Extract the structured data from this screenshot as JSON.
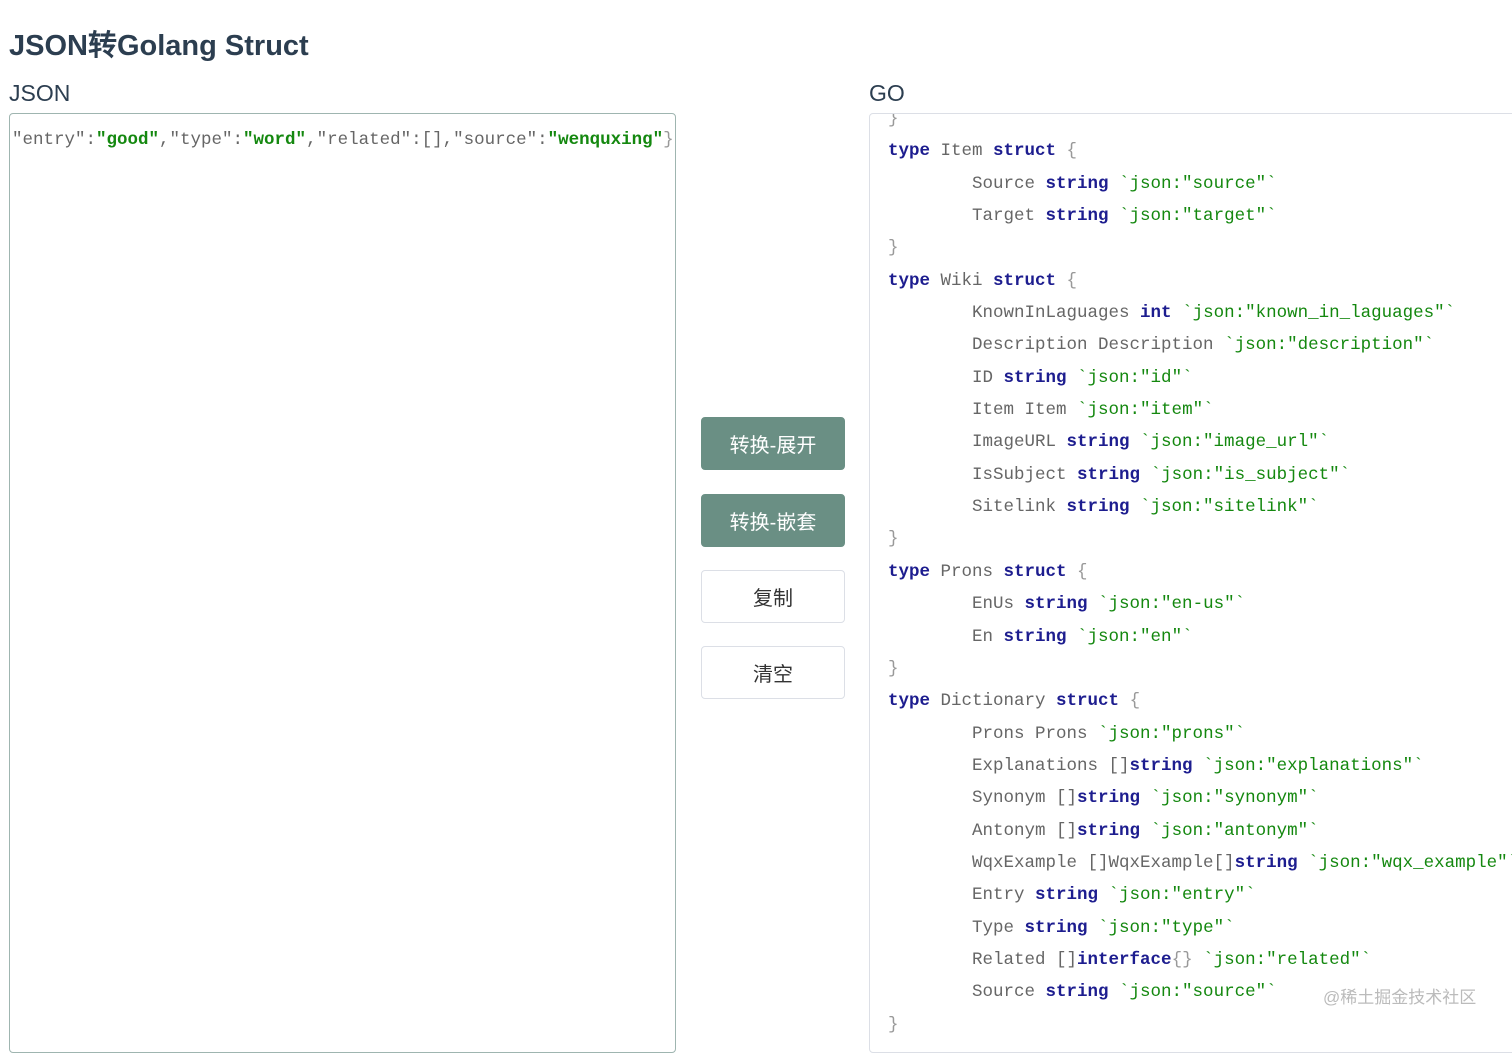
{
  "page_title": "JSON转Golang Struct",
  "json_panel": {
    "label": "JSON",
    "tokens": [
      [
        "i",
        "\"entry\":"
      ],
      [
        "sv",
        "\"good\""
      ],
      [
        "i",
        ",\"type\":"
      ],
      [
        "sv",
        "\"word\""
      ],
      [
        "i",
        ",\"related\":[],\"source\":"
      ],
      [
        "sv",
        "\"wenquxing\""
      ],
      [
        "p",
        "}}"
      ]
    ]
  },
  "go_panel": {
    "label": "GO",
    "lines": [
      [
        [
          "p",
          "}"
        ]
      ],
      [
        [
          "k",
          "type"
        ],
        [
          "i",
          " Item "
        ],
        [
          "k",
          "struct"
        ],
        [
          "p",
          " {"
        ]
      ],
      [
        [
          "i",
          "\tSource "
        ],
        [
          "k",
          "string"
        ],
        [
          "s",
          " `json:\"source\"`"
        ]
      ],
      [
        [
          "i",
          "\tTarget "
        ],
        [
          "k",
          "string"
        ],
        [
          "s",
          " `json:\"target\"`"
        ]
      ],
      [
        [
          "p",
          "}"
        ]
      ],
      [
        [
          "k",
          "type"
        ],
        [
          "i",
          " Wiki "
        ],
        [
          "k",
          "struct"
        ],
        [
          "p",
          " {"
        ]
      ],
      [
        [
          "i",
          "\tKnownInLaguages "
        ],
        [
          "k",
          "int"
        ],
        [
          "s",
          " `json:\"known_in_laguages\"`"
        ]
      ],
      [
        [
          "i",
          "\tDescription Description "
        ],
        [
          "s",
          "`json:\"description\"`"
        ]
      ],
      [
        [
          "i",
          "\tID "
        ],
        [
          "k",
          "string"
        ],
        [
          "s",
          " `json:\"id\"`"
        ]
      ],
      [
        [
          "i",
          "\tItem Item "
        ],
        [
          "s",
          "`json:\"item\"`"
        ]
      ],
      [
        [
          "i",
          "\tImageURL "
        ],
        [
          "k",
          "string"
        ],
        [
          "s",
          " `json:\"image_url\"`"
        ]
      ],
      [
        [
          "i",
          "\tIsSubject "
        ],
        [
          "k",
          "string"
        ],
        [
          "s",
          " `json:\"is_subject\"`"
        ]
      ],
      [
        [
          "i",
          "\tSitelink "
        ],
        [
          "k",
          "string"
        ],
        [
          "s",
          " `json:\"sitelink\"`"
        ]
      ],
      [
        [
          "p",
          "}"
        ]
      ],
      [
        [
          "k",
          "type"
        ],
        [
          "i",
          " Prons "
        ],
        [
          "k",
          "struct"
        ],
        [
          "p",
          " {"
        ]
      ],
      [
        [
          "i",
          "\tEnUs "
        ],
        [
          "k",
          "string"
        ],
        [
          "s",
          " `json:\"en-us\"`"
        ]
      ],
      [
        [
          "i",
          "\tEn "
        ],
        [
          "k",
          "string"
        ],
        [
          "s",
          " `json:\"en\"`"
        ]
      ],
      [
        [
          "p",
          "}"
        ]
      ],
      [
        [
          "k",
          "type"
        ],
        [
          "i",
          " Dictionary "
        ],
        [
          "k",
          "struct"
        ],
        [
          "p",
          " {"
        ]
      ],
      [
        [
          "i",
          "\tProns Prons "
        ],
        [
          "s",
          "`json:\"prons\"`"
        ]
      ],
      [
        [
          "i",
          "\tExplanations []"
        ],
        [
          "k",
          "string"
        ],
        [
          "s",
          " `json:\"explanations\"`"
        ]
      ],
      [
        [
          "i",
          "\tSynonym []"
        ],
        [
          "k",
          "string"
        ],
        [
          "s",
          " `json:\"synonym\"`"
        ]
      ],
      [
        [
          "i",
          "\tAntonym []"
        ],
        [
          "k",
          "string"
        ],
        [
          "s",
          " `json:\"antonym\"`"
        ]
      ],
      [
        [
          "i",
          "\tWqxExample []WqxExample[]"
        ],
        [
          "k",
          "string"
        ],
        [
          "s",
          " `json:\"wqx_example\"`"
        ]
      ],
      [
        [
          "i",
          "\tEntry "
        ],
        [
          "k",
          "string"
        ],
        [
          "s",
          " `json:\"entry\"`"
        ]
      ],
      [
        [
          "i",
          "\tType "
        ],
        [
          "k",
          "string"
        ],
        [
          "s",
          " `json:\"type\"`"
        ]
      ],
      [
        [
          "i",
          "\tRelated []"
        ],
        [
          "k",
          "interface"
        ],
        [
          "p",
          "{}"
        ],
        [
          "s",
          " `json:\"related\"`"
        ]
      ],
      [
        [
          "i",
          "\tSource "
        ],
        [
          "k",
          "string"
        ],
        [
          "s",
          " `json:\"source\"`"
        ]
      ],
      [
        [
          "p",
          "}"
        ]
      ]
    ]
  },
  "buttons": {
    "convert_expand": "转换-展开",
    "convert_nested": "转换-嵌套",
    "copy": "复制",
    "clear": "清空"
  },
  "colors": {
    "primary_button": "#6a8f84",
    "keyword": "#1d1d8f",
    "string": "#14880f"
  },
  "watermark": "@稀土掘金技术社区"
}
